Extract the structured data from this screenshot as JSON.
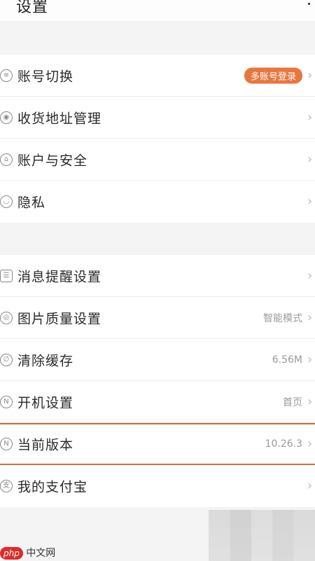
{
  "header": {
    "title": "设置",
    "back_icon": "chevron-left-icon",
    "more_icon": "more-dot-icon"
  },
  "group1": [
    {
      "name": "account-switch",
      "label": "账号切换",
      "badge": "多账号登录",
      "icon": "list-icon"
    },
    {
      "name": "shipping-address",
      "label": "收货地址管理",
      "icon": "location-pin-icon"
    },
    {
      "name": "account-security",
      "label": "账户与安全",
      "icon": "lock-icon"
    },
    {
      "name": "privacy",
      "label": "隐私",
      "icon": "eye-closed-icon"
    }
  ],
  "group2": [
    {
      "name": "notification-settings",
      "label": "消息提醒设置",
      "icon": "sliders-icon"
    },
    {
      "name": "image-quality",
      "label": "图片质量设置",
      "value": "智能模式",
      "icon": "image-pin-icon"
    },
    {
      "name": "clear-cache",
      "label": "清除缓存",
      "value": "6.56M",
      "icon": "broom-icon"
    },
    {
      "name": "startup-settings",
      "label": "开机设置",
      "value": "首页",
      "icon": "n-circle-icon"
    },
    {
      "name": "current-version",
      "label": "当前版本",
      "value": "10.26.3",
      "icon": "n-circle-icon"
    },
    {
      "name": "alipay",
      "label": "我的支付宝",
      "icon": "alipay-icon"
    }
  ],
  "colors": {
    "badge": "#e8773e",
    "highlight_border": "#d9683c"
  },
  "watermark": {
    "logo": "php",
    "text": "中文网"
  }
}
